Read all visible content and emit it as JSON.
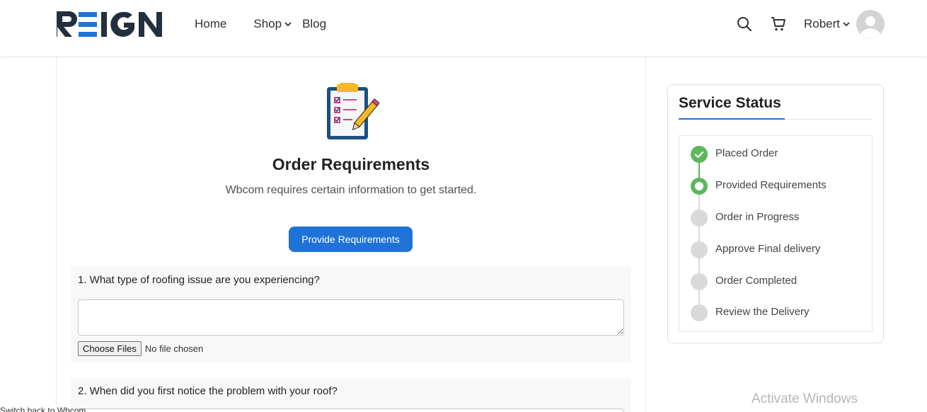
{
  "brand": {
    "logo_text": "REIGN",
    "logo_color": "#222f3e",
    "logo_accent": "#1f73d8"
  },
  "nav": {
    "home": "Home",
    "shop": "Shop",
    "blog": "Blog"
  },
  "header": {
    "user_name": "Robert",
    "icons": [
      "search-icon",
      "cart-icon",
      "chevron-down-icon",
      "avatar"
    ]
  },
  "order": {
    "title": "Order Requirements",
    "subtitle": "Wbcom requires certain information to get started.",
    "provide_button": "Provide Requirements"
  },
  "questions": [
    {
      "label": "1. What type of roofing issue are you experiencing?",
      "file_button": "Choose Files",
      "file_status": "No file chosen"
    },
    {
      "label": "2. When did you first notice the problem with your roof?"
    }
  ],
  "service_status": {
    "title": "Service Status",
    "steps": [
      {
        "label": "Placed Order",
        "state": "done"
      },
      {
        "label": "Provided Requirements",
        "state": "current"
      },
      {
        "label": "Order in Progress",
        "state": "pending"
      },
      {
        "label": "Approve Final delivery",
        "state": "pending"
      },
      {
        "label": "Order Completed",
        "state": "pending"
      },
      {
        "label": "Review the Delivery",
        "state": "pending"
      }
    ],
    "colors": {
      "done": "#5cb85c",
      "pending": "#d9d9d9",
      "accent": "#1f73d8"
    }
  },
  "footer": {
    "switch_back": "Switch back to Wbcom",
    "activate_windows": "Activate Windows"
  }
}
